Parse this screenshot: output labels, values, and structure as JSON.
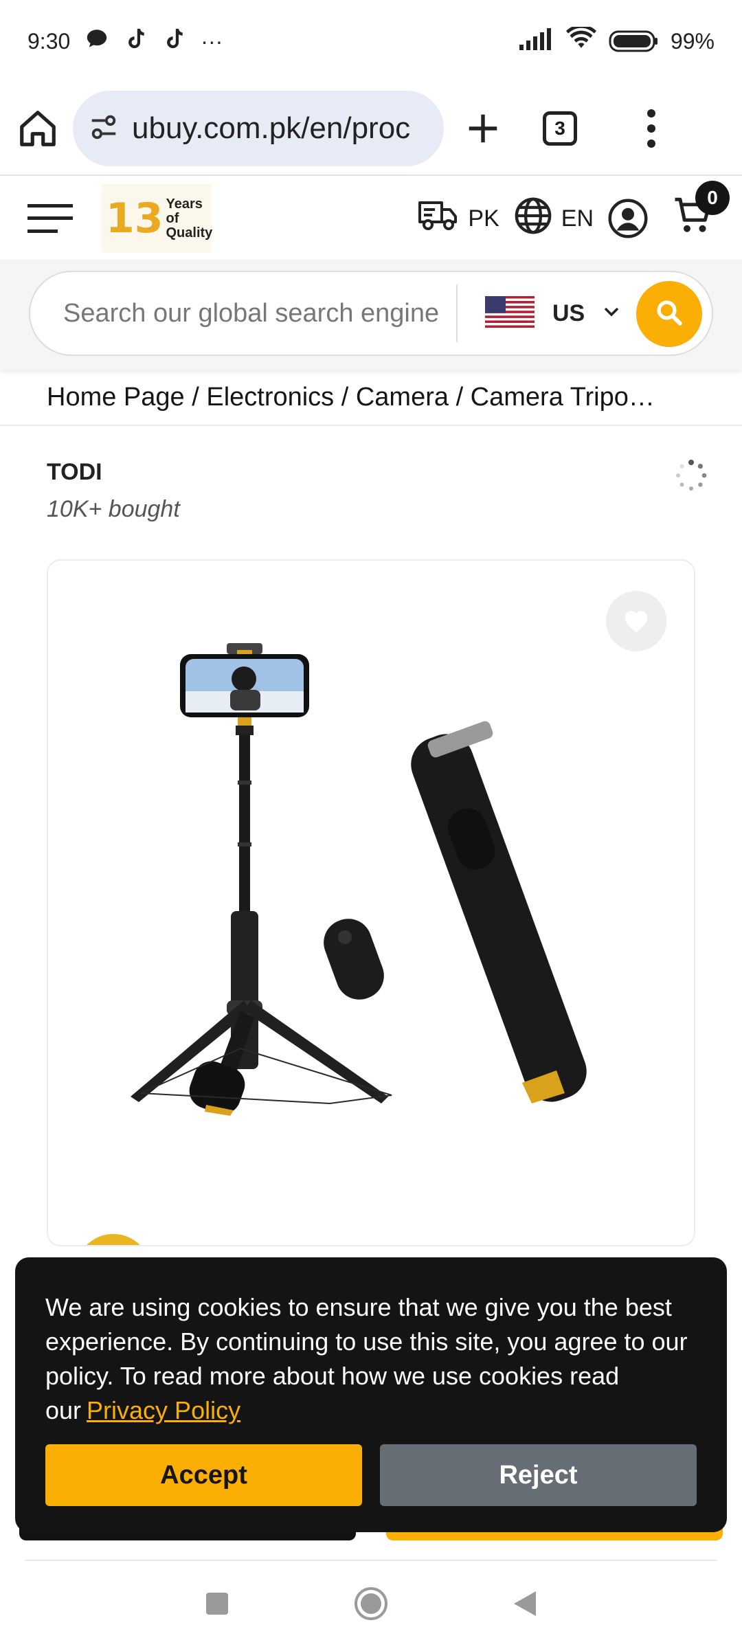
{
  "status_bar": {
    "time": "9:30",
    "more": "···",
    "battery": "99%"
  },
  "browser": {
    "url": "ubuy.com.pk/en/proc",
    "tab_count": "3"
  },
  "header": {
    "logo_number": "13",
    "logo_text_line1": "Years of",
    "logo_text_line2": "Quality",
    "shipping_country": "PK",
    "language": "EN",
    "cart_count": "0"
  },
  "search": {
    "placeholder": "Search our global search engine",
    "country": "US"
  },
  "breadcrumb": {
    "text": "Home Page / Electronics / Camera / Camera Tripo…"
  },
  "product": {
    "brand": "TODI",
    "bought": "10K+ bought"
  },
  "cookie": {
    "text": "We are using cookies to ensure that we give you the best experience. By continuing to use this site, you agree to our policy. To read more about how we use cookies read our",
    "link_label": "Privacy Policy",
    "accept_label": "Accept",
    "reject_label": "Reject"
  },
  "colors": {
    "accent": "#fbae04",
    "dark": "#141414",
    "reject": "#676d74"
  }
}
